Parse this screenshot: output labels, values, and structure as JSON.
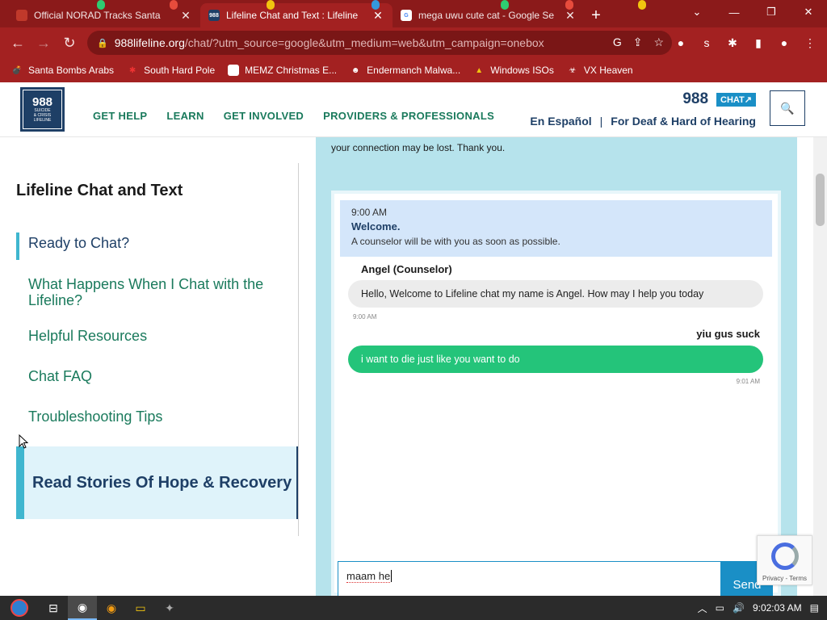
{
  "browser": {
    "tabs": [
      {
        "title": "Official NORAD Tracks Santa",
        "active": false,
        "favicon_color": "#c0392b"
      },
      {
        "title": "Lifeline Chat and Text : Lifeline",
        "active": true,
        "favicon_color": "#1e3f66"
      },
      {
        "title": "mega uwu cute cat - Google Se",
        "active": false,
        "favicon_color": "#4285f4"
      }
    ],
    "new_tab_label": "+",
    "address": {
      "host": "988lifeline.org",
      "path": "/chat/?utm_source=google&utm_medium=web&utm_campaign=onebox"
    },
    "bookmarks": [
      {
        "label": "Santa Bombs Arabs"
      },
      {
        "label": "South Hard Pole"
      },
      {
        "label": "MEMZ Christmas E..."
      },
      {
        "label": "Endermanch Malwa..."
      },
      {
        "label": "Windows ISOs"
      },
      {
        "label": "VX Heaven"
      }
    ]
  },
  "site": {
    "logo": {
      "number": "988",
      "line1": "SUICIDE",
      "line2": "& CRISIS",
      "line3": "LIFELINE"
    },
    "nav": [
      "GET HELP",
      "LEARN",
      "GET INVOLVED",
      "PROVIDERS & PROFESSIONALS"
    ],
    "header_number": "988",
    "chat_button": "CHAT",
    "link_espanol": "En Español",
    "link_deaf": "For Deaf & Hard of Hearing"
  },
  "sidebar": {
    "title": "Lifeline Chat and Text",
    "items": [
      {
        "label": "Ready to Chat?",
        "active": true
      },
      {
        "label": "What Happens When I Chat with the Lifeline?",
        "active": false
      },
      {
        "label": "Helpful Resources",
        "active": false
      },
      {
        "label": "Chat FAQ",
        "active": false
      },
      {
        "label": "Troubleshooting Tips",
        "active": false
      }
    ],
    "stories_label": "Read Stories Of Hope & Recovery"
  },
  "chat": {
    "notice": "your connection may be lost. Thank you.",
    "welcome": {
      "time": "9:00 AM",
      "heading": "Welcome.",
      "message": "A counselor will be with you as soon as possible."
    },
    "counselor_name": "Angel (Counselor)",
    "counselor_message": "Hello, Welcome to Lifeline chat my name is Angel. How may I help you today",
    "counselor_time": "9:00 AM",
    "user_name": "yiu gus suck",
    "user_message": "i want to die just like you want to do",
    "user_time": "9:01 AM",
    "input_value": "maam he",
    "send_label": "Send",
    "recaptcha_text": "Privacy - Terms"
  },
  "taskbar": {
    "clock": "9:02:03 AM"
  }
}
